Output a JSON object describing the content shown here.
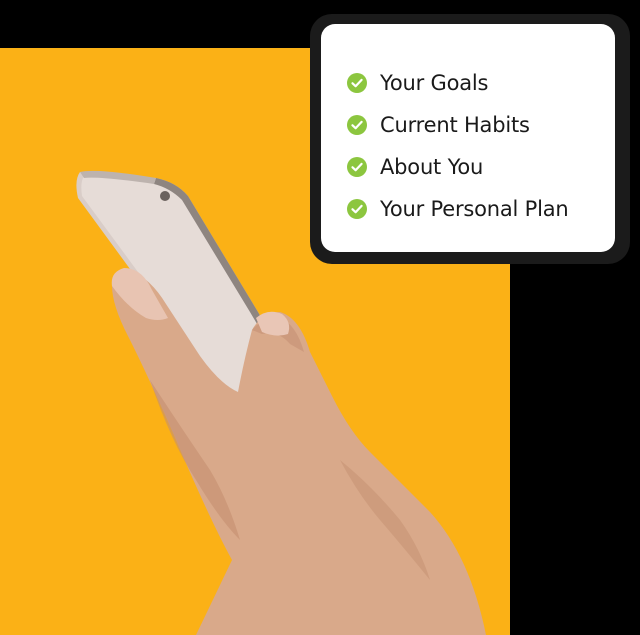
{
  "checklist": {
    "items": [
      {
        "label": "Your Goals"
      },
      {
        "label": "Current Habits"
      },
      {
        "label": "About You"
      },
      {
        "label": "Your Personal Plan"
      }
    ],
    "check_icon": "check-circle-icon",
    "check_color": "#8cc63f"
  },
  "colors": {
    "background": "#fbb116",
    "card": "#ffffff",
    "text": "#1a1a1a"
  }
}
